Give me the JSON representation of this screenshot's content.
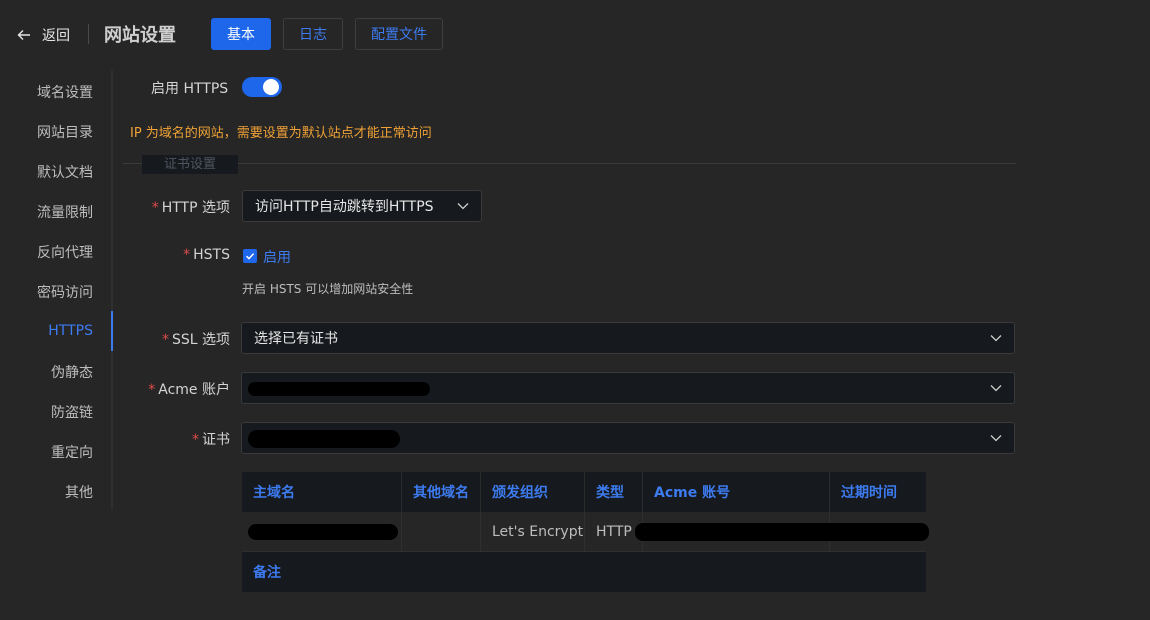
{
  "header": {
    "back_label": "返回",
    "title": "网站设置",
    "tabs": [
      "基本",
      "日志",
      "配置文件"
    ]
  },
  "sidebar": {
    "items": [
      "域名设置",
      "网站目录",
      "默认文档",
      "流量限制",
      "反向代理",
      "密码访问",
      "HTTPS",
      "伪静态",
      "防盗链",
      "重定向",
      "其他"
    ],
    "active": "HTTPS"
  },
  "form": {
    "https_label": "启用 HTTPS",
    "https_enabled": true,
    "warning": "IP 为域名的网站，需要设置为默认站点才能正常访问",
    "section_title": "证书设置",
    "required_mark": "*",
    "http_option_label": "HTTP 选项",
    "http_option_value": "访问HTTP自动跳转到HTTPS",
    "hsts_label": "HSTS",
    "hsts_checkbox_label": "启用",
    "hsts_checked": true,
    "hsts_hint": "开启 HSTS 可以增加网站安全性",
    "ssl_option_label": "SSL 选项",
    "ssl_option_value": "选择已有证书",
    "acme_label": "Acme 账户",
    "cert_label": "证书"
  },
  "table": {
    "headers": [
      "主域名",
      "其他域名",
      "颁发组织",
      "类型",
      "Acme 账号",
      "过期时间"
    ],
    "row": {
      "issuer": "Let's Encrypt",
      "type": "HTTP"
    },
    "remark_header": "备注"
  },
  "colors": {
    "accent": "#1e66ea",
    "link": "#3d7bf0",
    "warning": "#f0a236",
    "background": "#262626",
    "input_bg": "#16191d"
  },
  "icons": [
    "arrow-left-icon",
    "chevron-down-icon",
    "checkmark-icon"
  ]
}
